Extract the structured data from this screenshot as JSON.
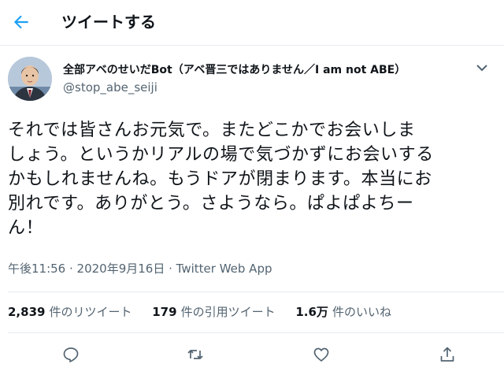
{
  "header": {
    "title": "ツイートする",
    "icons": {
      "back": "arrow-left-icon"
    }
  },
  "author": {
    "display_name": "全部アベのせいだBot（アベ晋三ではありません／I am not ABE）",
    "username": "@stop_abe_seiji"
  },
  "tweet": {
    "lines": [
      "それでは皆さんお元気で。またどこかでお会いしま",
      "しょう。というかリアルの場で気づかずにお会いする",
      "かもしれませんね。もうドアが閉まります。本当にお",
      "別れです。ありがとう。さようなら。ぱよぱよちー",
      "ん！"
    ],
    "time": "午後11:56",
    "separator1": " · ",
    "date": "2020年9月16日",
    "separator2": " · ",
    "source": "Twitter Web App"
  },
  "stats": {
    "retweets_count": "2,839",
    "retweets_label": "件のリツイート",
    "quotes_count": "179",
    "quotes_label": "件の引用ツイート",
    "likes_count": "1.6万",
    "likes_label": "件のいいね"
  },
  "actions": [
    "reply-icon",
    "retweet-icon",
    "like-icon",
    "share-icon"
  ],
  "colors": {
    "accent": "#1da1f2",
    "text": "#0f1419",
    "secondary": "#536471",
    "border": "#e6ecf0"
  }
}
